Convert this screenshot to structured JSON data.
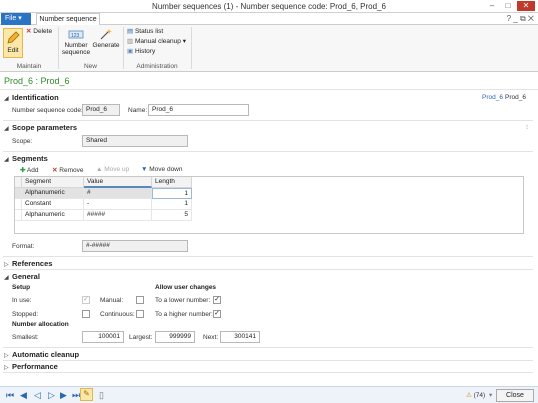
{
  "window": {
    "title": "Number sequences (1) - Number sequence code: Prod_6, Prod_6",
    "minimize": "–",
    "maximize": "□",
    "close": "✕"
  },
  "tabs": {
    "file": "File",
    "file_arrow": "▾",
    "active": "Number sequence",
    "help": "? _ ⧉ ✕"
  },
  "ribbon": {
    "maintain": {
      "label": "Maintain",
      "edit": "Edit",
      "delete": "Delete"
    },
    "new": {
      "label": "New",
      "number_sequence": "Number sequence",
      "generate": "Generate"
    },
    "administration": {
      "label": "Administration",
      "status_list": "Status list",
      "manual_cleanup": "Manual cleanup",
      "history": "History"
    }
  },
  "form": {
    "header": "Prod_6 : Prod_6",
    "breadcrumb_link": "Prod_6",
    "breadcrumb_current": "Prod_6"
  },
  "identification": {
    "title": "Identification",
    "code_label": "Number sequence code:",
    "code_value": "Prod_6",
    "name_label": "Name:",
    "name_value": "Prod_6"
  },
  "scope": {
    "title": "Scope parameters",
    "scope_label": "Scope:",
    "scope_value": "Shared"
  },
  "segments": {
    "title": "Segments",
    "add": "Add",
    "remove": "Remove",
    "move_up": "Move up",
    "move_down": "Move down",
    "columns": [
      "Segment",
      "Value",
      "Length"
    ],
    "rows": [
      {
        "segment": "Alphanumeric",
        "value": "#",
        "length": "1"
      },
      {
        "segment": "Constant",
        "value": "-",
        "length": "1"
      },
      {
        "segment": "Alphanumeric",
        "value": "#####",
        "length": "5"
      }
    ],
    "format_label": "Format:",
    "format_value": "#-#####"
  },
  "references": {
    "title": "References"
  },
  "general": {
    "title": "General",
    "setup_title": "Setup",
    "in_use": "In use:",
    "manual": "Manual:",
    "stopped": "Stopped:",
    "continuous": "Continuous:",
    "allow_title": "Allow user changes",
    "to_lower": "To a lower number:",
    "to_higher": "To a higher number:",
    "allocation_title": "Number allocation",
    "smallest_label": "Smallest:",
    "smallest_value": "100001",
    "largest_label": "Largest:",
    "largest_value": "999999",
    "next_label": "Next:",
    "next_value": "300141",
    "check": "✓"
  },
  "automatic_cleanup": {
    "title": "Automatic cleanup"
  },
  "performance": {
    "title": "Performance"
  },
  "statusbar": {
    "notifications": "(74)",
    "close": "Close"
  }
}
